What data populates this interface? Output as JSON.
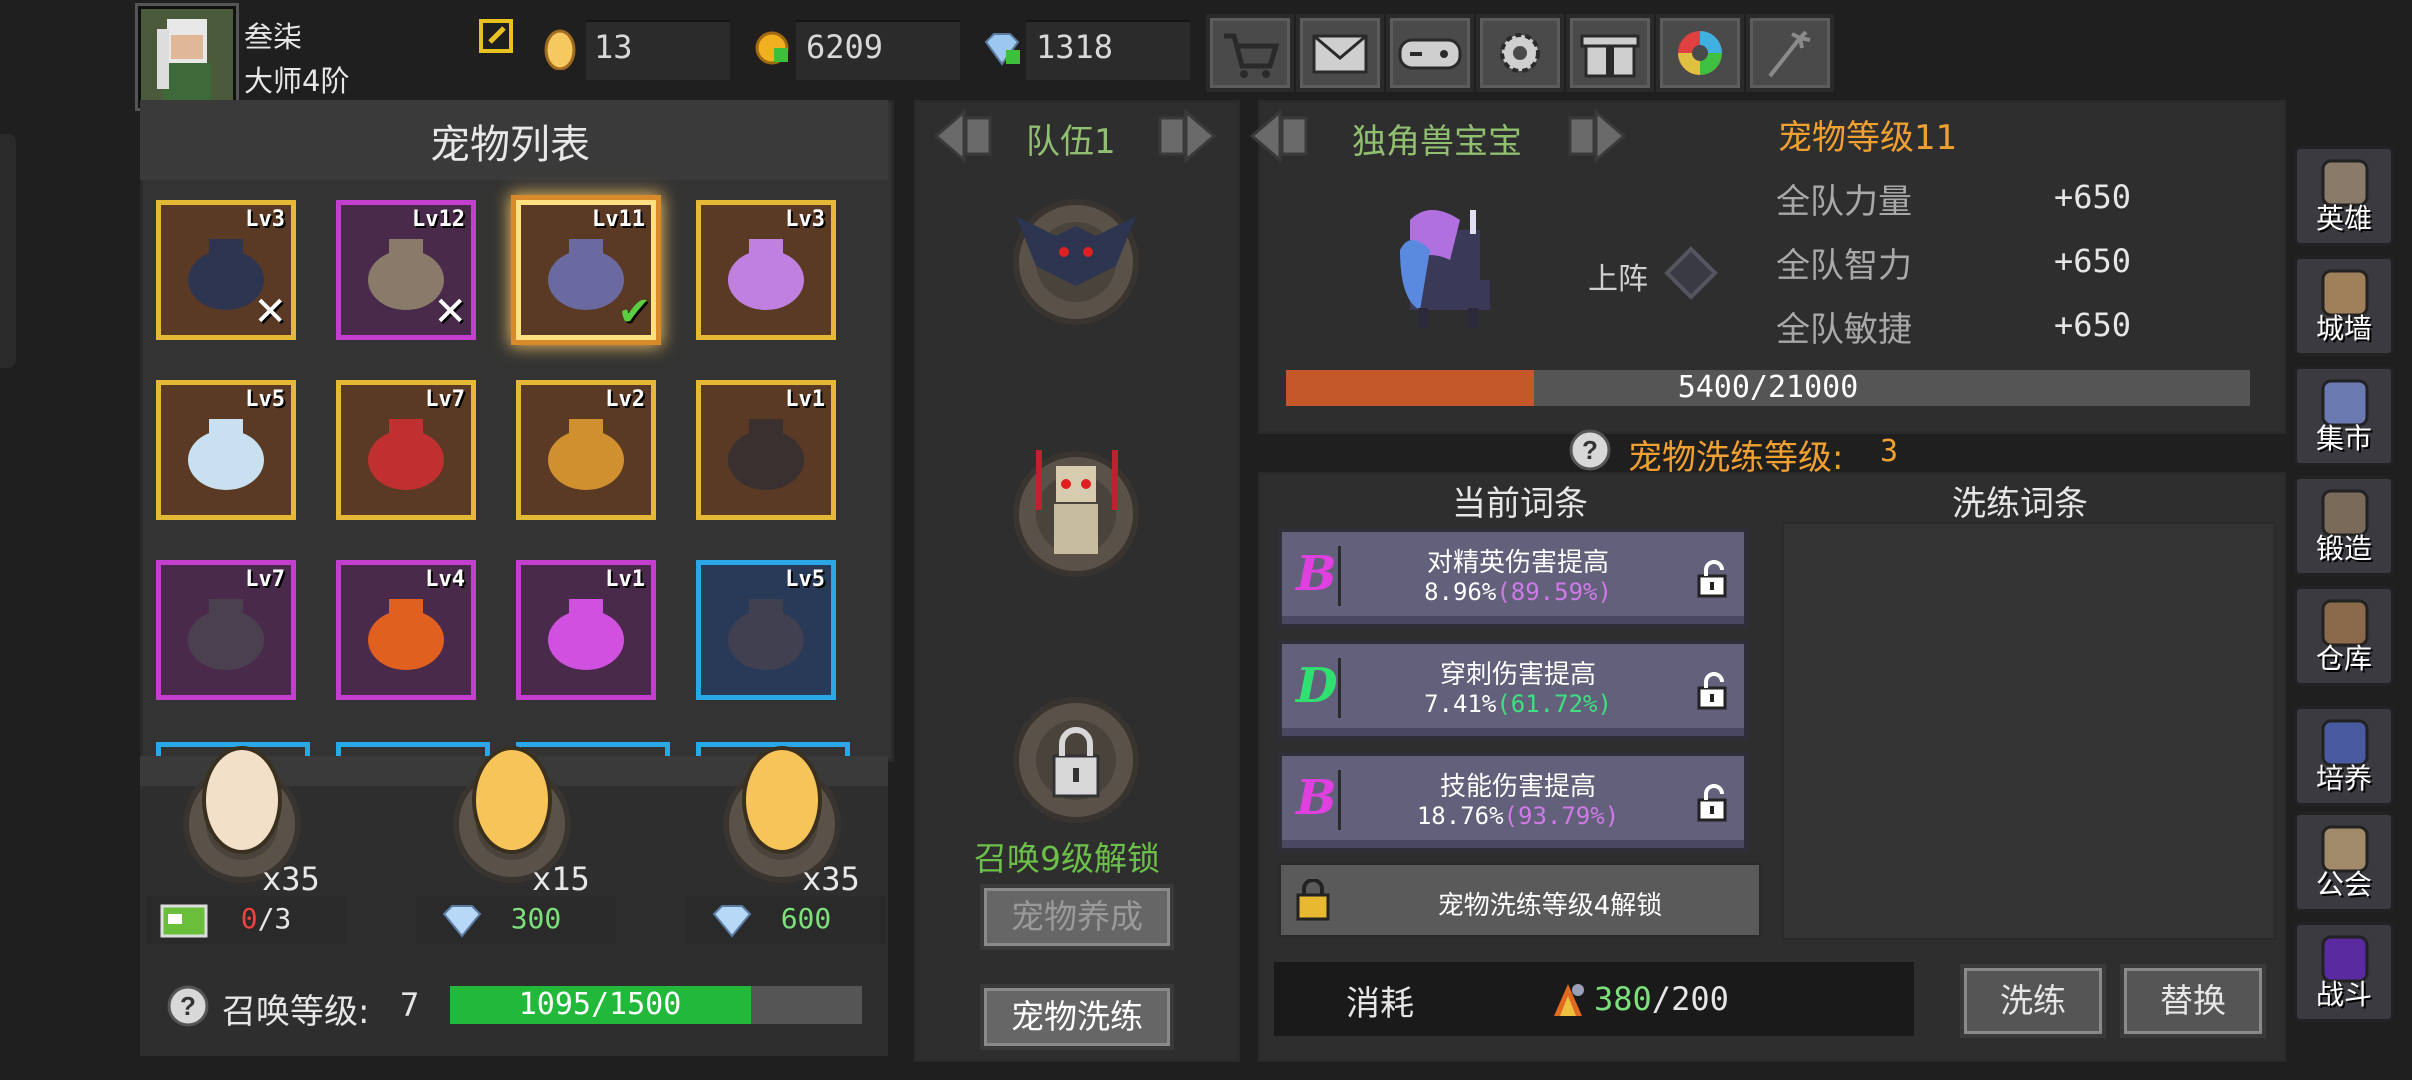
{
  "player": {
    "name": "叁柒",
    "rank": "大师4阶"
  },
  "resources": [
    {
      "icon": "egg-icon",
      "value": "13"
    },
    {
      "icon": "gold-coin-icon",
      "value": "6209"
    },
    {
      "icon": "diamond-icon",
      "value": "1318"
    }
  ],
  "top_buttons": [
    "cart-icon",
    "mail-icon",
    "gamepad-icon",
    "gear-icon",
    "gift-icon",
    "color-wheel-icon",
    "fireworks-icon"
  ],
  "pet_list": {
    "title": "宠物列表",
    "pets": [
      {
        "level": "Lv3",
        "rarity": "gold",
        "mark": "x"
      },
      {
        "level": "Lv12",
        "rarity": "purple",
        "mark": "x"
      },
      {
        "level": "Lv11",
        "rarity": "gold",
        "mark": "check",
        "selected": true
      },
      {
        "level": "Lv3",
        "rarity": "gold",
        "mark": ""
      },
      {
        "level": "Lv5",
        "rarity": "gold",
        "mark": ""
      },
      {
        "level": "Lv7",
        "rarity": "gold",
        "mark": ""
      },
      {
        "level": "Lv2",
        "rarity": "gold",
        "mark": ""
      },
      {
        "level": "Lv1",
        "rarity": "gold",
        "mark": ""
      },
      {
        "level": "Lv7",
        "rarity": "purple",
        "mark": ""
      },
      {
        "level": "Lv4",
        "rarity": "purple",
        "mark": ""
      },
      {
        "level": "Lv1",
        "rarity": "purple",
        "mark": ""
      },
      {
        "level": "Lv5",
        "rarity": "blue",
        "mark": ""
      }
    ]
  },
  "summon": {
    "eggs": [
      {
        "count": "x35",
        "cost_icon": "ad-video-icon",
        "cost": "0",
        "cost_max": "/3"
      },
      {
        "count": "x15",
        "cost_icon": "diamond-icon",
        "cost": "300"
      },
      {
        "count": "x35",
        "cost_icon": "diamond-icon",
        "cost": "600"
      }
    ],
    "level_label": "召唤等级:",
    "level": "7",
    "progress_text": "1095/1500",
    "progress": 0.73
  },
  "team": {
    "title": "队伍1",
    "unlock_text": "召唤9级解锁",
    "nurture_button": "宠物养成",
    "refine_button": "宠物洗练"
  },
  "pet_detail": {
    "name": "独角兽宝宝",
    "level_text": "宠物等级11",
    "deploy_label": "上阵",
    "stats": [
      {
        "label": "全队力量",
        "value": "+650"
      },
      {
        "label": "全队智力",
        "value": "+650"
      },
      {
        "label": "全队敏捷",
        "value": "+650"
      }
    ],
    "exp_text": "5400/21000",
    "exp_progress": 0.257
  },
  "refine": {
    "level_label": "宠物洗练等级:",
    "level": "3",
    "current_header": "当前词条",
    "refine_header": "洗练词条",
    "affixes": [
      {
        "grade": "B",
        "grade_color": "#e040e0",
        "name": "对精英伤害提高",
        "value": "8.96%",
        "pct": "(89.59%)",
        "pct_color": "#d07ae8"
      },
      {
        "grade": "D",
        "grade_color": "#30e070",
        "name": "穿刺伤害提高",
        "value": "7.41%",
        "pct": "(61.72%)",
        "pct_color": "#40e080"
      },
      {
        "grade": "B",
        "grade_color": "#e040e0",
        "name": "技能伤害提高",
        "value": "18.76%",
        "pct": "(93.79%)",
        "pct_color": "#d07ae8"
      }
    ],
    "locked_text": "宠物洗练等级4解锁",
    "cost_label": "消耗",
    "cost_have": "380",
    "cost_need": "/200",
    "refine_button": "洗练",
    "replace_button": "替换"
  },
  "side_menu": [
    {
      "label": "英雄",
      "icon": "helmet-icon"
    },
    {
      "label": "城墙",
      "icon": "castle-wall-icon"
    },
    {
      "label": "集市",
      "icon": "market-icon"
    },
    {
      "label": "锻造",
      "icon": "anvil-icon"
    },
    {
      "label": "仓库",
      "icon": "warehouse-icon"
    },
    {
      "label": "培养",
      "icon": "trophy-icon"
    },
    {
      "label": "公会",
      "icon": "guild-icon"
    },
    {
      "label": "战斗",
      "icon": "portal-icon"
    }
  ],
  "colors": {
    "gold_border": "#e5b935",
    "purple_border": "#c23fcf",
    "blue_border": "#2aa7e6",
    "orange_text": "#f0a030",
    "green_bar": "#22b83a",
    "exp_bar": "#c4582a"
  }
}
